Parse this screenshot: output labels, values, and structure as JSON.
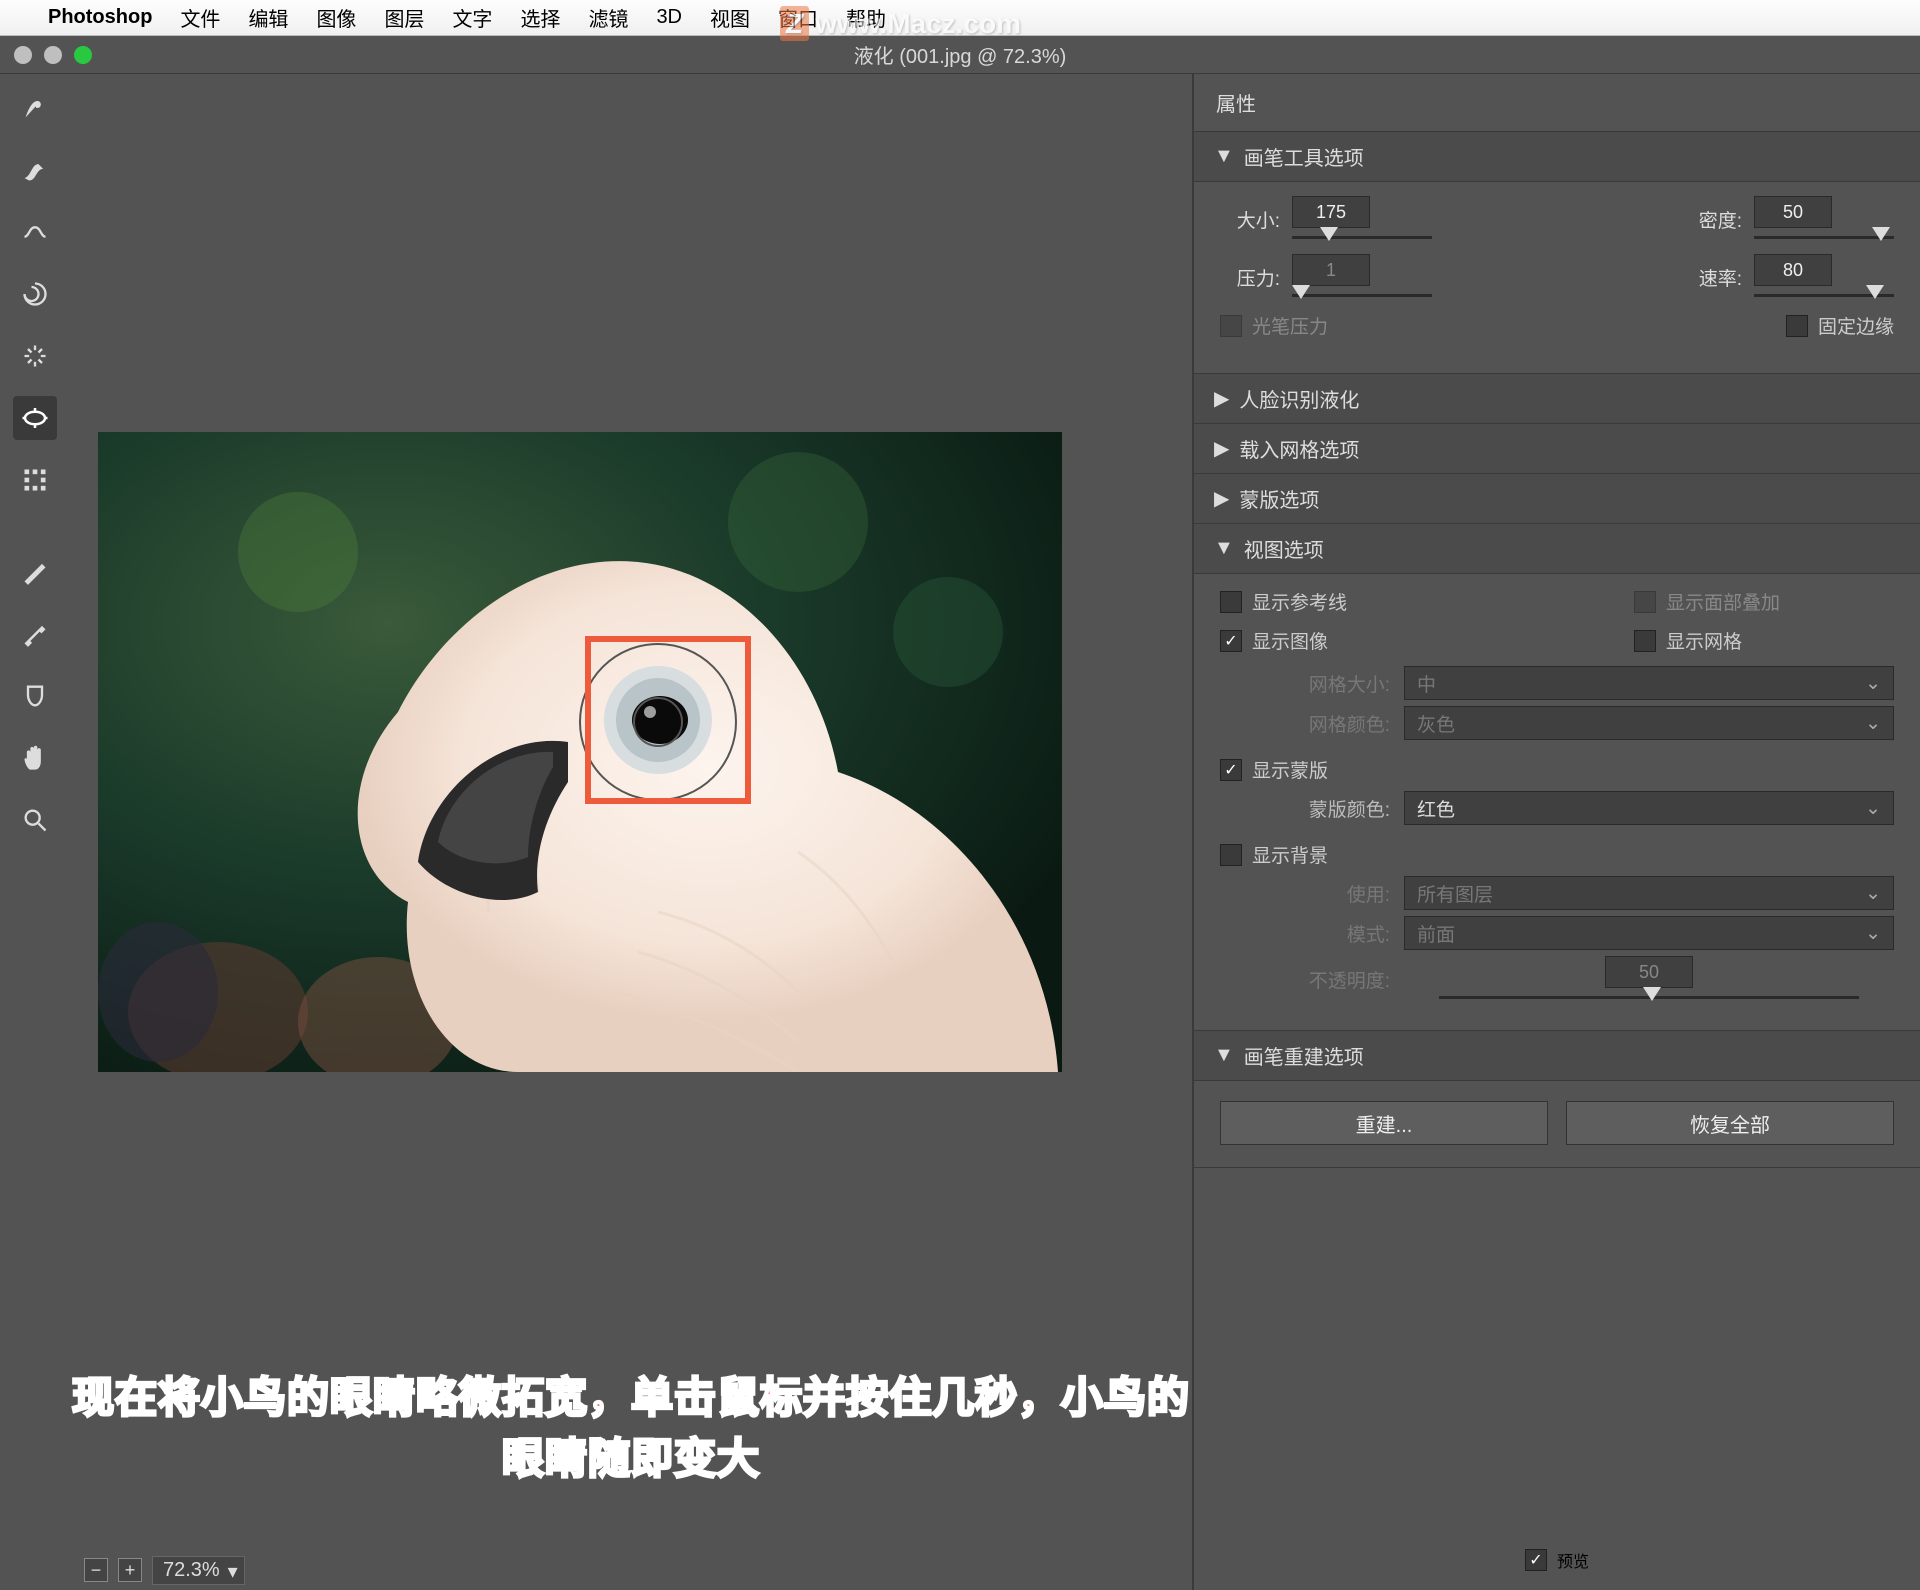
{
  "menubar": {
    "appname": "Photoshop",
    "items": [
      "文件",
      "编辑",
      "图像",
      "图层",
      "文字",
      "选择",
      "滤镜",
      "3D",
      "视图",
      "窗口",
      "帮助"
    ]
  },
  "watermark": "www.Macz.com",
  "titlebar": {
    "title": "液化 (001.jpg @ 72.3%)"
  },
  "statusbar": {
    "zoom": "72.3%"
  },
  "panel": {
    "title": "属性",
    "brush": {
      "header": "画笔工具选项",
      "size_label": "大小:",
      "size": "175",
      "density_label": "密度:",
      "density": "50",
      "pressure_label": "压力:",
      "pressure": "1",
      "rate_label": "速率:",
      "rate": "80",
      "pen_pressure": "光笔压力",
      "pin_edges": "固定边缘"
    },
    "face": {
      "header": "人脸识别液化"
    },
    "mesh": {
      "header": "载入网格选项"
    },
    "mask": {
      "header": "蒙版选项"
    },
    "view": {
      "header": "视图选项",
      "show_guides": "显示参考线",
      "show_face_overlay": "显示面部叠加",
      "show_image": "显示图像",
      "show_mesh": "显示网格",
      "mesh_size_label": "网格大小:",
      "mesh_size_value": "中",
      "mesh_color_label": "网格颜色:",
      "mesh_color_value": "灰色",
      "show_mask": "显示蒙版",
      "mask_color_label": "蒙版颜色:",
      "mask_color_value": "红色",
      "show_bg": "显示背景",
      "use_label": "使用:",
      "use_value": "所有图层",
      "mode_label": "模式:",
      "mode_value": "前面",
      "opacity_label": "不透明度:",
      "opacity_value": "50"
    },
    "rebuild": {
      "header": "画笔重建选项",
      "rebuild_btn": "重建...",
      "restore_btn": "恢复全部"
    },
    "preview": "预览"
  },
  "caption": "现在将小鸟的眼睛略微拓宽，单击鼠标并按住几秒，小鸟的眼睛随即变大"
}
